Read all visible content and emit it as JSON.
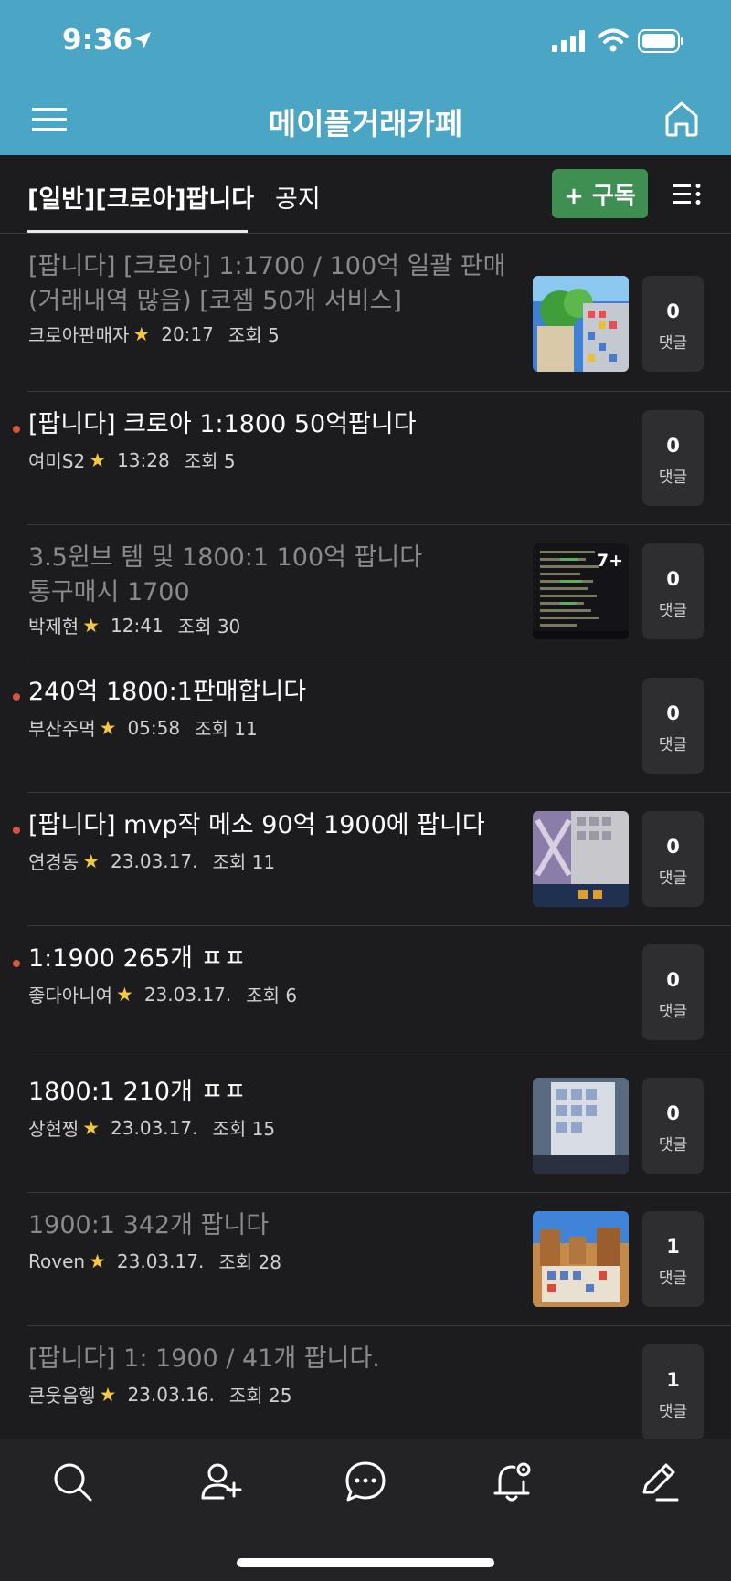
{
  "status_bar": {
    "time": "9:36"
  },
  "nav": {
    "title": "메이플거래카페"
  },
  "tabs": {
    "main": "[일반][크로아]팝니다",
    "notice": "공지"
  },
  "subscribe": {
    "label": "+ 구독"
  },
  "posts": [
    {
      "title": "[팝니다] [크로아] 1:1700 / 100억 일괄 판매 (거래내역 많음) [코젬 50개 서비스]",
      "author": "크로아판매자",
      "time": "20:17",
      "views": "조회 5",
      "comments": "0",
      "comment_label": "댓글",
      "read": true,
      "unread_dot": false,
      "thumb": "thumb-game-a"
    },
    {
      "title": "[팝니다] 크로아 1:1800 50억팝니다",
      "author": "여미S2",
      "time": "13:28",
      "views": "조회 5",
      "comments": "0",
      "comment_label": "댓글",
      "read": false,
      "unread_dot": true,
      "thumb": null
    },
    {
      "title": "3.5윈브 템 및 1800:1 100억 팝니다 통구매시 1700",
      "author": "박제현",
      "time": "12:41",
      "views": "조회 30",
      "comments": "0",
      "comment_label": "댓글",
      "read": true,
      "unread_dot": false,
      "thumb": "thumb-stats",
      "thumb_badge": "7+"
    },
    {
      "title": "240억 1800:1판매합니다",
      "author": "부산주먹",
      "time": "05:58",
      "views": "조회 11",
      "comments": "0",
      "comment_label": "댓글",
      "read": false,
      "unread_dot": true,
      "thumb": null
    },
    {
      "title": "[팝니다] mvp작 메소 90억 1900에 팝니다",
      "author": "연경동",
      "time": "23.03.17.",
      "views": "조회 11",
      "comments": "0",
      "comment_label": "댓글",
      "read": false,
      "unread_dot": true,
      "thumb": "thumb-game-b"
    },
    {
      "title": "1:1900 265개 ㅍㅍ",
      "author": "좋다아니여",
      "time": "23.03.17.",
      "views": "조회 6",
      "comments": "0",
      "comment_label": "댓글",
      "read": false,
      "unread_dot": true,
      "thumb": null
    },
    {
      "title": "1800:1 210개 ㅍㅍ",
      "author": "상현찡",
      "time": "23.03.17.",
      "views": "조회 15",
      "comments": "0",
      "comment_label": "댓글",
      "read": false,
      "unread_dot": false,
      "thumb": "thumb-game-c"
    },
    {
      "title": "1900:1 342개 팝니다",
      "author": "Roven",
      "time": "23.03.17.",
      "views": "조회 28",
      "comments": "1",
      "comment_label": "댓글",
      "read": true,
      "unread_dot": false,
      "thumb": "thumb-game-d"
    },
    {
      "title": "[팝니다] 1: 1900 / 41개 팝니다.",
      "author": "큰웃음헿",
      "time": "23.03.16.",
      "views": "조회 25",
      "comments": "1",
      "comment_label": "댓글",
      "read": true,
      "unread_dot": false,
      "thumb": null
    }
  ],
  "bottom_bar": {
    "icons": [
      "search-icon",
      "add-member-icon",
      "chat-icon",
      "notification-settings-icon",
      "write-icon"
    ]
  },
  "colors": {
    "header": "#4ba5c4",
    "background": "#1c1c1e",
    "subscribe": "#3f8f52",
    "unread_dot": "#d9533f",
    "star": "#f5c842"
  }
}
